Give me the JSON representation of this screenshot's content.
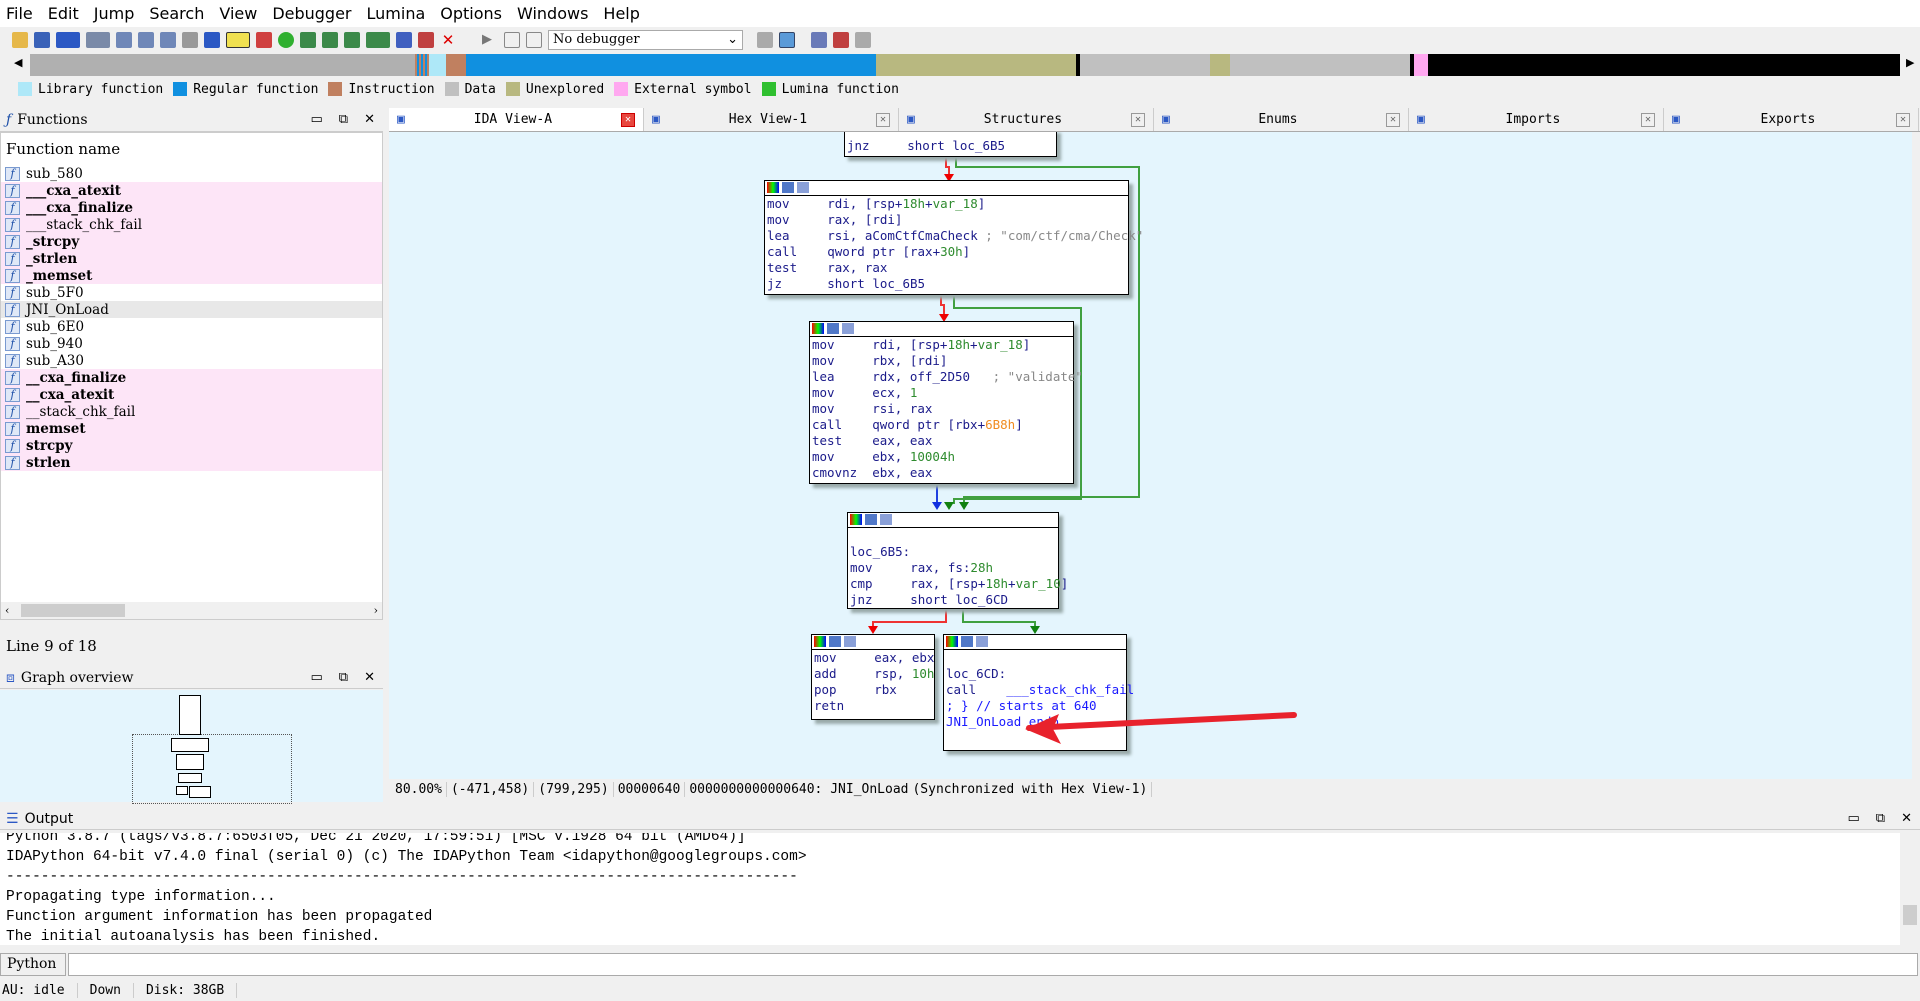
{
  "menu": [
    "File",
    "Edit",
    "Jump",
    "Search",
    "View",
    "Debugger",
    "Lumina",
    "Options",
    "Windows",
    "Help"
  ],
  "toolbar": {
    "debugger_select": "No debugger"
  },
  "legend": [
    {
      "label": "Library function",
      "color": "#aee8f8"
    },
    {
      "label": "Regular function",
      "color": "#1090e0"
    },
    {
      "label": "Instruction",
      "color": "#c08060"
    },
    {
      "label": "Data",
      "color": "#c0c0c0"
    },
    {
      "label": "Unexplored",
      "color": "#b8b880"
    },
    {
      "label": "External symbol",
      "color": "#ffa8f0"
    },
    {
      "label": "Lumina function",
      "color": "#30c030"
    }
  ],
  "functions": {
    "title": "Functions",
    "column": "Function name",
    "status": "Line 9 of 18",
    "items": [
      {
        "name": "sub_580",
        "style": "normal"
      },
      {
        "name": "___cxa_atexit",
        "style": "pink-bold"
      },
      {
        "name": "___cxa_finalize",
        "style": "pink-bold"
      },
      {
        "name": "___stack_chk_fail",
        "style": "pink"
      },
      {
        "name": "_strcpy",
        "style": "pink-bold"
      },
      {
        "name": "_strlen",
        "style": "pink-bold"
      },
      {
        "name": "_memset",
        "style": "pink-bold"
      },
      {
        "name": "sub_5F0",
        "style": "normal"
      },
      {
        "name": "JNI_OnLoad",
        "style": "selected"
      },
      {
        "name": "sub_6E0",
        "style": "normal"
      },
      {
        "name": "sub_940",
        "style": "normal"
      },
      {
        "name": "sub_A30",
        "style": "normal"
      },
      {
        "name": "__cxa_finalize",
        "style": "pink-bold"
      },
      {
        "name": "__cxa_atexit",
        "style": "pink-bold"
      },
      {
        "name": "__stack_chk_fail",
        "style": "pink"
      },
      {
        "name": "memset",
        "style": "pink-bold"
      },
      {
        "name": "strcpy",
        "style": "pink-bold"
      },
      {
        "name": "strlen",
        "style": "pink-bold"
      }
    ]
  },
  "graph_overview": {
    "title": "Graph overview"
  },
  "tabs": [
    {
      "label": "IDA View-A",
      "active": true
    },
    {
      "label": "Hex View-1"
    },
    {
      "label": "Structures"
    },
    {
      "label": "Enums"
    },
    {
      "label": "Imports"
    },
    {
      "label": "Exports"
    }
  ],
  "blocks": {
    "b1": [
      "jnz     short loc_6B5"
    ],
    "b2": [
      "mov     rdi, [rsp+18h+var_18]",
      "mov     rax, [rdi]",
      "lea     rsi, aComCtfCmaCheck ; \"com/ctf/cma/Check\"",
      "call    qword ptr [rax+30h]",
      "test    rax, rax",
      "jz      short loc_6B5"
    ],
    "b3": [
      "mov     rdi, [rsp+18h+var_18]",
      "mov     rbx, [rdi]",
      "lea     rdx, off_2D50   ; \"validate\"",
      "mov     ecx, 1",
      "mov     rsi, rax",
      "call    qword ptr [rbx+6B8h]",
      "test    eax, eax",
      "mov     ebx, 10004h",
      "cmovnz  ebx, eax"
    ],
    "b4": [
      "",
      "loc_6B5:",
      "mov     rax, fs:28h",
      "cmp     rax, [rsp+18h+var_10]",
      "jnz     short loc_6CD"
    ],
    "b5": [
      "mov     eax, ebx",
      "add     rsp, 10h",
      "pop     rbx",
      "retn"
    ],
    "b6": [
      "",
      "loc_6CD:",
      "call    ___stack_chk_fail",
      "; } // starts at 640",
      "JNI_OnLoad endp"
    ]
  },
  "status": {
    "zoom": "80.00%",
    "coords1": "(-471,458)",
    "coords2": "(799,295)",
    "offset": "00000640",
    "address": "0000000000000640: JNI_OnLoad",
    "sync": "(Synchronized with Hex View-1)"
  },
  "output": {
    "title": "Output",
    "lines": [
      "Python 3.8.7 (tags/v3.8.7:6503f05, Dec 21 2020, 17:59:51) [MSC v.1928 64 bit (AMD64)]",
      "IDAPython 64-bit v7.4.0 final (serial 0) (c) The IDAPython Team <idapython@googlegroups.com>",
      "-------------------------------------------------------------------------------------------",
      "Propagating type information...",
      "Function argument information has been propagated",
      "The initial autoanalysis has been finished."
    ],
    "lang_button": "Python"
  },
  "statusbar": {
    "au": "AU:  idle",
    "dir": "Down",
    "disk": "Disk: 38GB"
  }
}
